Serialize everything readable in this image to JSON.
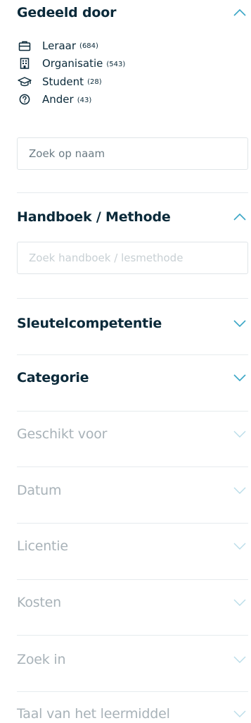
{
  "colors": {
    "accent": "#3aa6c6",
    "accent_muted": "#b9dce8",
    "heading": "#0b2a3a",
    "muted_text": "#a8b2b8",
    "divider": "#e6ebee"
  },
  "shared_by": {
    "title": "Gedeeld door",
    "expanded": true,
    "items": [
      {
        "icon": "briefcase-icon",
        "label": "Leraar",
        "count": "(684)"
      },
      {
        "icon": "building-icon",
        "label": "Organisatie",
        "count": "(543)"
      },
      {
        "icon": "graduation-cap-icon",
        "label": "Student",
        "count": "(28)"
      },
      {
        "icon": "question-circle-icon",
        "label": "Ander",
        "count": "(43)"
      }
    ],
    "search_placeholder": "Zoek op naam"
  },
  "handbook": {
    "title": "Handboek / Methode",
    "expanded": true,
    "search_placeholder": "Zoek handboek / lesmethode"
  },
  "sections": [
    {
      "title": "Sleutelcompetentie",
      "enabled": true
    },
    {
      "title": "Categorie",
      "enabled": true
    },
    {
      "title": "Geschikt voor",
      "enabled": false
    },
    {
      "title": "Datum",
      "enabled": false
    },
    {
      "title": "Licentie",
      "enabled": false
    },
    {
      "title": "Kosten",
      "enabled": false
    },
    {
      "title": "Zoek in",
      "enabled": false
    },
    {
      "title": "Taal van het leermiddel",
      "enabled": false
    }
  ]
}
